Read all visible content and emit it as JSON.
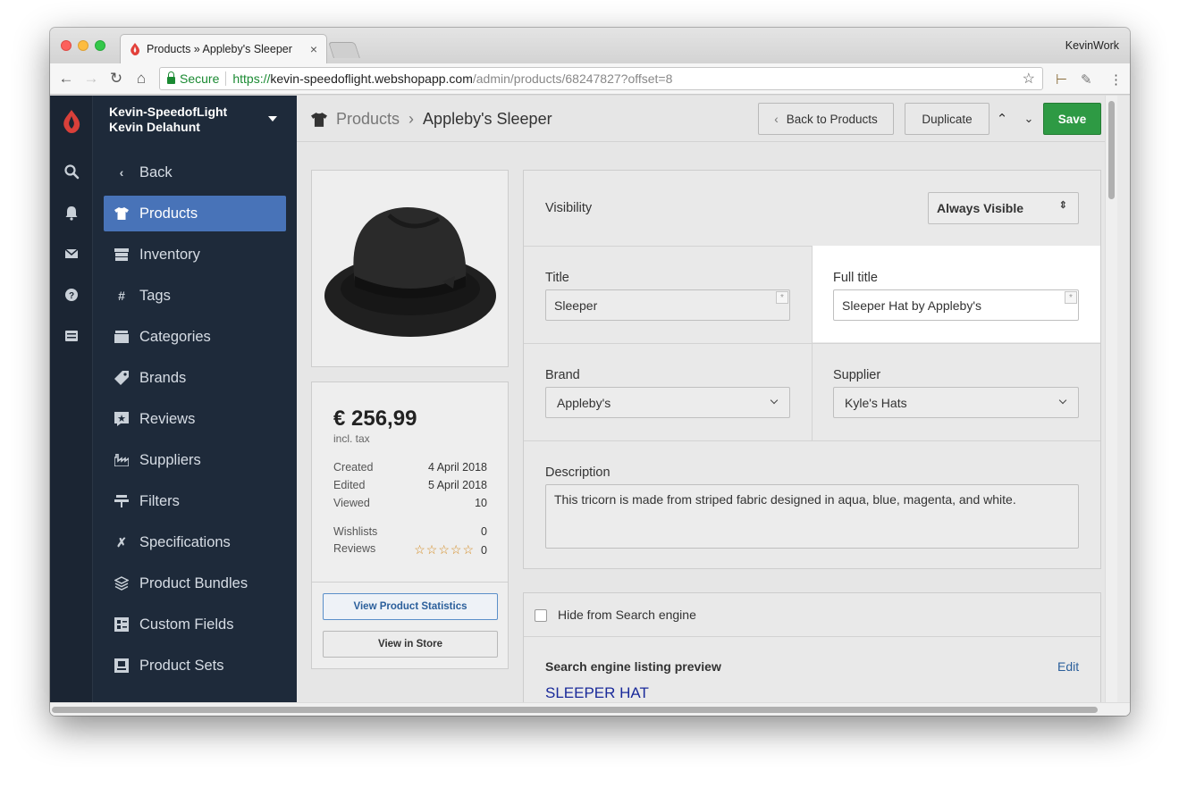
{
  "browser": {
    "tab_title": "Products » Appleby's Sleeper",
    "profile_name": "KevinWork",
    "secure_label": "Secure",
    "url_scheme": "https://",
    "url_host": "kevin-speedoflight.webshopapp.com",
    "url_path": "/admin/products/68247827?offset=8"
  },
  "account": {
    "shop_name": "Kevin-SpeedofLight",
    "user_name": "Kevin Delahunt"
  },
  "sidebar": {
    "items": [
      {
        "label": "Back",
        "icon": "chevron-left-icon"
      },
      {
        "label": "Products",
        "icon": "tshirt-icon",
        "active": true
      },
      {
        "label": "Inventory",
        "icon": "inventory-icon"
      },
      {
        "label": "Tags",
        "icon": "hash-icon"
      },
      {
        "label": "Categories",
        "icon": "folder-icon"
      },
      {
        "label": "Brands",
        "icon": "tag-icon"
      },
      {
        "label": "Reviews",
        "icon": "review-star-icon"
      },
      {
        "label": "Suppliers",
        "icon": "factory-icon"
      },
      {
        "label": "Filters",
        "icon": "filter-icon"
      },
      {
        "label": "Specifications",
        "icon": "tools-icon"
      },
      {
        "label": "Product Bundles",
        "icon": "layers-icon"
      },
      {
        "label": "Custom Fields",
        "icon": "custom-fields-icon"
      },
      {
        "label": "Product Sets",
        "icon": "product-sets-icon"
      }
    ]
  },
  "header": {
    "breadcrumb_root": "Products",
    "breadcrumb_current": "Appleby's Sleeper",
    "back_label": "Back to Products",
    "duplicate_label": "Duplicate",
    "save_label": "Save"
  },
  "summary": {
    "price": "€ 256,99",
    "price_note": "incl. tax",
    "created_label": "Created",
    "created_value": "4 April 2018",
    "edited_label": "Edited",
    "edited_value": "5 April 2018",
    "viewed_label": "Viewed",
    "viewed_value": "10",
    "wishlists_label": "Wishlists",
    "wishlists_value": "0",
    "reviews_label": "Reviews",
    "reviews_value": "0",
    "rating": 0,
    "stats_button": "View Product Statistics",
    "store_button": "View in Store"
  },
  "form": {
    "visibility_label": "Visibility",
    "visibility_value": "Always Visible",
    "title_label": "Title",
    "title_value": "Sleeper",
    "full_title_label": "Full title",
    "full_title_value": "Sleeper Hat by Appleby's",
    "brand_label": "Brand",
    "brand_value": "Appleby's",
    "supplier_label": "Supplier",
    "supplier_value": "Kyle's Hats",
    "description_label": "Description",
    "description_value": "This tricorn is made from striped fabric designed in aqua, blue, magenta, and white."
  },
  "seo": {
    "hide_label": "Hide from Search engine",
    "preview_label": "Search engine listing preview",
    "edit_label": "Edit",
    "preview_title": "SLEEPER HAT"
  },
  "colors": {
    "accent": "#4873b8",
    "save": "#2e9a44",
    "sidebar": "#1e2a3a",
    "link": "#2b5f9b"
  }
}
